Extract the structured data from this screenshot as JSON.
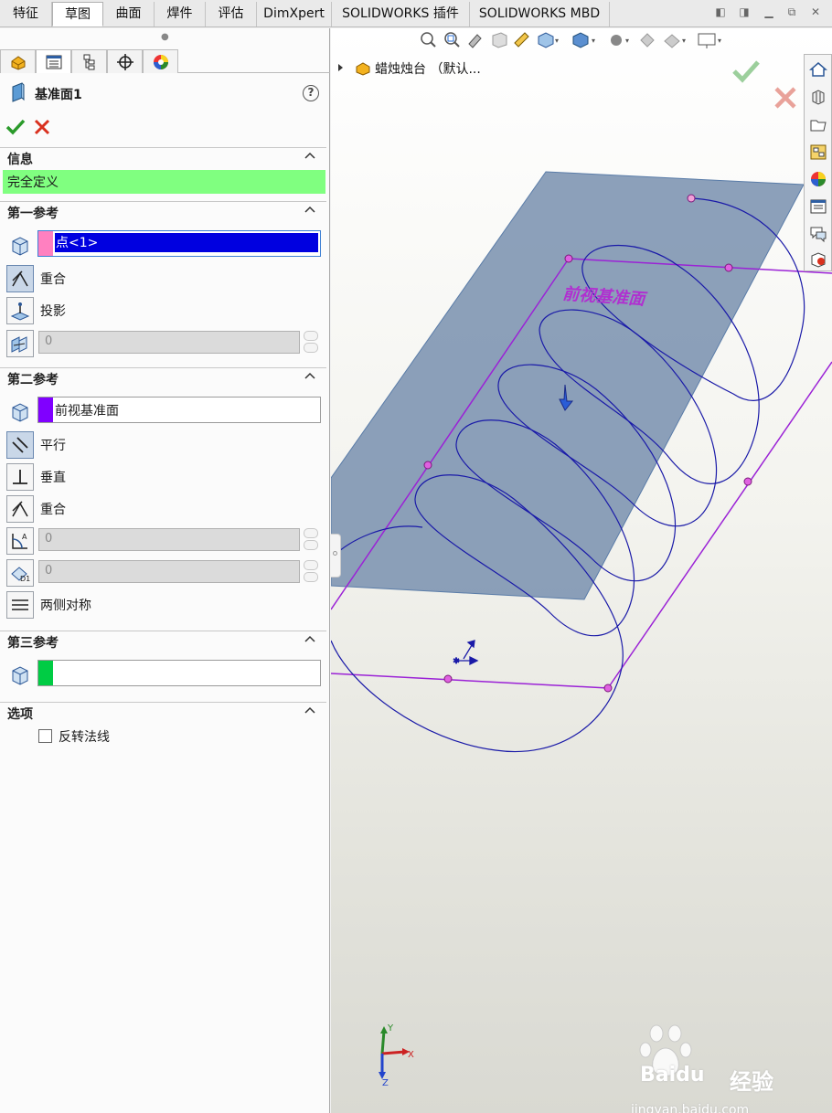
{
  "tabs": [
    "特征",
    "草图",
    "曲面",
    "焊件",
    "评估",
    "DimXpert",
    "SOLIDWORKS 插件",
    "SOLIDWORKS MBD"
  ],
  "active_tab": "草图",
  "window_controls": [
    "restore-left-icon",
    "restore-right-icon",
    "minimize-icon",
    "maximize-icon",
    "close-icon"
  ],
  "panel": {
    "tab_icons": [
      "feature-manager-icon",
      "property-manager-icon",
      "configuration-manager-icon",
      "dimxpert-manager-icon",
      "display-manager-icon"
    ],
    "title": "基准面1",
    "help": "?",
    "info_section": {
      "label": "信息",
      "status": "完全定义",
      "status_color": "#80ff80"
    },
    "ref1": {
      "label": "第一参考",
      "selection": "点<1>",
      "swatch_color": "#ff80c0",
      "options": {
        "coincident": "重合",
        "project": "投影"
      },
      "distance_value": "0"
    },
    "ref2": {
      "label": "第二参考",
      "selection": "前视基准面",
      "swatch_color": "#8000ff",
      "options": {
        "parallel": "平行",
        "perpendicular": "垂直",
        "coincident": "重合",
        "mid_plane": "两侧对称"
      },
      "angle_value": "0",
      "distance_value": "0"
    },
    "ref3": {
      "label": "第三参考",
      "selection": "",
      "swatch_color": "#00cc44"
    },
    "options_section": {
      "label": "选项",
      "flip_normal": "反转法线",
      "flip_checked": false
    }
  },
  "viewport": {
    "tree_item": "蜡烛烛台 （默认...",
    "plane_label": "前视基准面",
    "plane_color": "#7c93b0",
    "helix_color": "#1a1aa8",
    "sketch_color": "#9b22d6",
    "axis_labels": {
      "x": "X",
      "y": "Y",
      "z": "Z"
    },
    "watermark": {
      "brand": "Baidu",
      "brand_suffix": "经验",
      "url": "jingyan.baidu.com"
    }
  }
}
